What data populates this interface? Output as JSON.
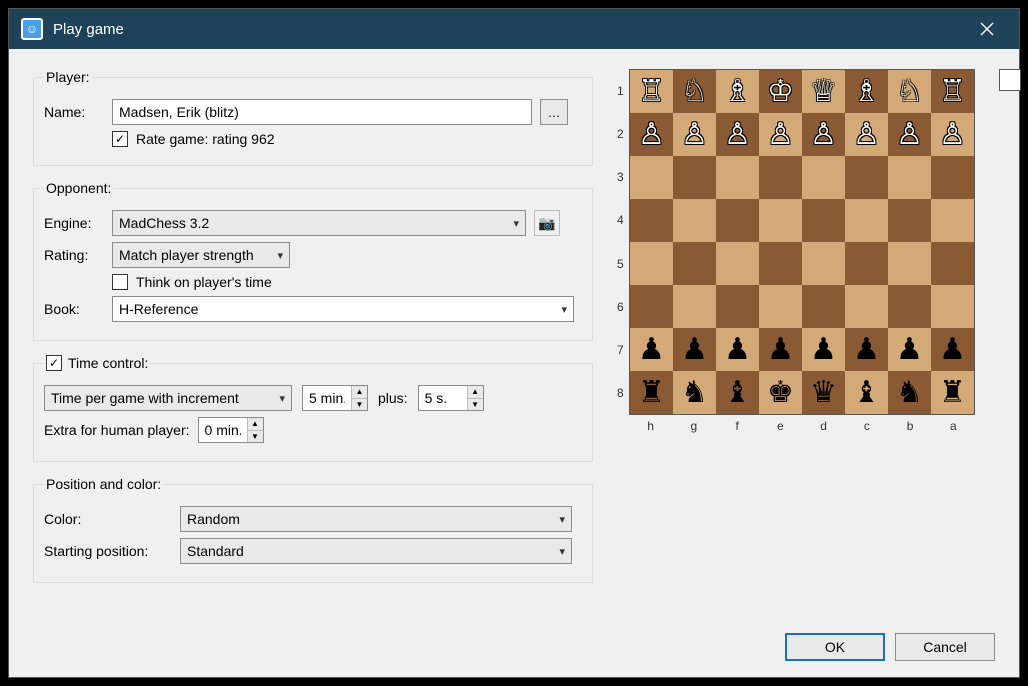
{
  "window": {
    "title": "Play game"
  },
  "player": {
    "legend": "Player:",
    "name_label": "Name:",
    "name_value": "Madsen, Erik (blitz)",
    "rate_label": "Rate game: rating 962"
  },
  "opponent": {
    "legend": "Opponent:",
    "engine_label": "Engine:",
    "engine_value": "MadChess 3.2",
    "rating_label": "Rating:",
    "rating_value": "Match player strength",
    "think_label": "Think on player's time",
    "book_label": "Book:",
    "book_value": "H-Reference"
  },
  "time": {
    "legend": "Time control:",
    "type_value": "Time per game with increment",
    "minutes_value": "5 min.",
    "plus_label": "plus:",
    "seconds_value": "5 s.",
    "extra_label": "Extra for human player:",
    "extra_value": "0 min."
  },
  "position": {
    "legend": "Position and color:",
    "color_label": "Color:",
    "color_value": "Random",
    "start_label": "Starting position:",
    "start_value": "Standard"
  },
  "buttons": {
    "ok": "OK",
    "cancel": "Cancel"
  },
  "board": {
    "ranks": [
      "1",
      "2",
      "3",
      "4",
      "5",
      "6",
      "7",
      "8"
    ],
    "files": [
      "h",
      "g",
      "f",
      "e",
      "d",
      "c",
      "b",
      "a"
    ],
    "rows": [
      [
        {
          "g": "♖",
          "c": "w"
        },
        {
          "g": "♘",
          "c": "w"
        },
        {
          "g": "♗",
          "c": "w"
        },
        {
          "g": "♔",
          "c": "w"
        },
        {
          "g": "♕",
          "c": "w"
        },
        {
          "g": "♗",
          "c": "w"
        },
        {
          "g": "♘",
          "c": "w"
        },
        {
          "g": "♖",
          "c": "w"
        }
      ],
      [
        {
          "g": "♙",
          "c": "w"
        },
        {
          "g": "♙",
          "c": "w"
        },
        {
          "g": "♙",
          "c": "w"
        },
        {
          "g": "♙",
          "c": "w"
        },
        {
          "g": "♙",
          "c": "w"
        },
        {
          "g": "♙",
          "c": "w"
        },
        {
          "g": "♙",
          "c": "w"
        },
        {
          "g": "♙",
          "c": "w"
        }
      ],
      [
        null,
        null,
        null,
        null,
        null,
        null,
        null,
        null
      ],
      [
        null,
        null,
        null,
        null,
        null,
        null,
        null,
        null
      ],
      [
        null,
        null,
        null,
        null,
        null,
        null,
        null,
        null
      ],
      [
        null,
        null,
        null,
        null,
        null,
        null,
        null,
        null
      ],
      [
        {
          "g": "♟",
          "c": "b"
        },
        {
          "g": "♟",
          "c": "b"
        },
        {
          "g": "♟",
          "c": "b"
        },
        {
          "g": "♟",
          "c": "b"
        },
        {
          "g": "♟",
          "c": "b"
        },
        {
          "g": "♟",
          "c": "b"
        },
        {
          "g": "♟",
          "c": "b"
        },
        {
          "g": "♟",
          "c": "b"
        }
      ],
      [
        {
          "g": "♜",
          "c": "b"
        },
        {
          "g": "♞",
          "c": "b"
        },
        {
          "g": "♝",
          "c": "b"
        },
        {
          "g": "♚",
          "c": "b"
        },
        {
          "g": "♛",
          "c": "b"
        },
        {
          "g": "♝",
          "c": "b"
        },
        {
          "g": "♞",
          "c": "b"
        },
        {
          "g": "♜",
          "c": "b"
        }
      ]
    ]
  }
}
